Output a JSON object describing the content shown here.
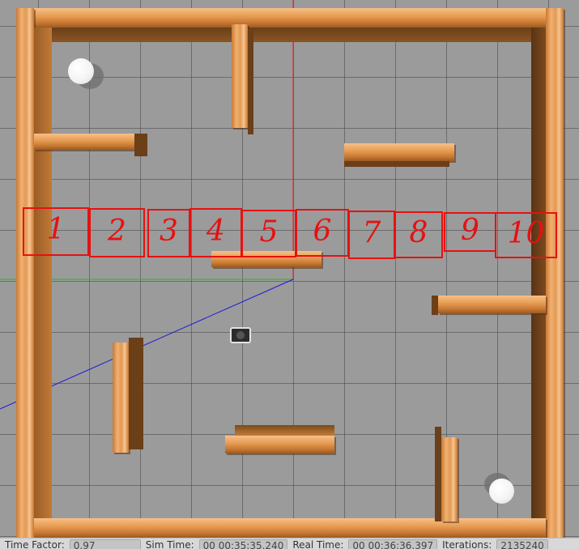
{
  "scene": {
    "zones": [
      {
        "label": "1"
      },
      {
        "label": "2"
      },
      {
        "label": "3"
      },
      {
        "label": "4"
      },
      {
        "label": "5"
      },
      {
        "label": "6"
      },
      {
        "label": "7"
      },
      {
        "label": "8"
      },
      {
        "label": "9"
      },
      {
        "label": "10"
      }
    ],
    "zone_color": "#e81010",
    "wall_color": "#e8a060",
    "ground_color": "#9b9b9b"
  },
  "statusbar": {
    "time_factor_label": "Time Factor:",
    "time_factor_value": "0.97",
    "sim_time_label": "Sim Time:",
    "sim_time_value": "00 00:35:35.240",
    "real_time_label": "Real Time:",
    "real_time_value": "00 00:36:36.397",
    "iterations_label": "Iterations:",
    "iterations_value": "2135240"
  }
}
